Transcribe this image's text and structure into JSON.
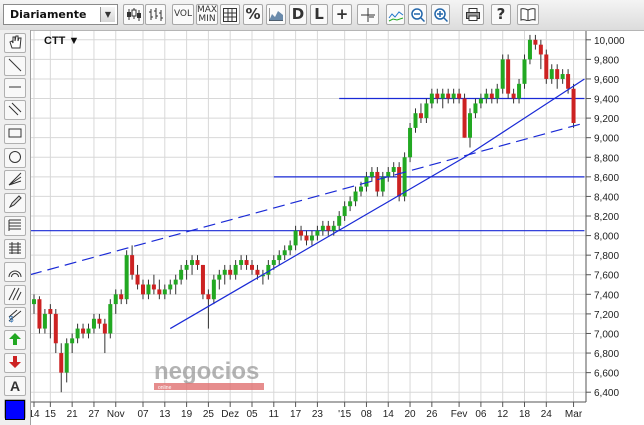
{
  "toolbar": {
    "period": "Diariamente",
    "buttons": [
      {
        "name": "candlestick-chart-button",
        "text": ""
      },
      {
        "name": "ohlc-chart-button",
        "text": ""
      },
      {
        "name": "volume-button",
        "text": "VOL"
      },
      {
        "name": "max-min-button",
        "text": "MAX MIN"
      },
      {
        "name": "grid-button",
        "text": ""
      },
      {
        "name": "percent-button",
        "text": "%"
      },
      {
        "name": "area-chart-button",
        "text": ""
      },
      {
        "name": "scale-d-button",
        "text": "D"
      },
      {
        "name": "scale-l-button",
        "text": "L"
      },
      {
        "name": "crosshair-button",
        "text": "+"
      },
      {
        "name": "cursor-button",
        "text": "+"
      },
      {
        "name": "zoom-area-button",
        "text": ""
      },
      {
        "name": "zoom-out-button",
        "text": ""
      },
      {
        "name": "zoom-in-button",
        "text": ""
      },
      {
        "name": "print-button",
        "text": ""
      },
      {
        "name": "help-button",
        "text": "?"
      },
      {
        "name": "book-button",
        "text": ""
      }
    ]
  },
  "sidebar": {
    "tools": [
      "hand-icon",
      "line-icon",
      "horizontal-line-icon",
      "channel-icon",
      "rectangle-icon",
      "ellipse-icon",
      "fan-icon",
      "pencil-icon",
      "fibonacci-icon",
      "grid-lines-icon",
      "arc-icon",
      "parallel-icon",
      "dollar-lines-icon",
      "arrow-up-icon",
      "arrow-down-icon",
      "text-icon",
      "delete-icon"
    ],
    "text_tool": "A",
    "color": "#0000ff"
  },
  "watermark": {
    "main": "negocios",
    "sub": "online"
  },
  "chart_data": {
    "type": "candlestick",
    "symbol": "CTT",
    "ylim": [
      6300,
      10100
    ],
    "yticks": [
      6400,
      6600,
      6800,
      7000,
      7200,
      7400,
      7600,
      7800,
      8000,
      8200,
      8400,
      8600,
      8800,
      9000,
      9200,
      9400,
      9600,
      9800,
      10000
    ],
    "ytick_labels": [
      "6,400",
      "6,600",
      "6,800",
      "7,000",
      "7,200",
      "7,400",
      "7,600",
      "7,800",
      "8,000",
      "8,200",
      "8,400",
      "8,600",
      "8,800",
      "9,000",
      "9,200",
      "9,400",
      "9,600",
      "9,800",
      "10,000"
    ],
    "xticks": [
      {
        "label": "14",
        "i": 0
      },
      {
        "label": "15",
        "i": 3
      },
      {
        "label": "21",
        "i": 7
      },
      {
        "label": "27",
        "i": 11
      },
      {
        "label": "Nov",
        "i": 15
      },
      {
        "label": "07",
        "i": 20
      },
      {
        "label": "13",
        "i": 24
      },
      {
        "label": "19",
        "i": 28
      },
      {
        "label": "25",
        "i": 32
      },
      {
        "label": "Dez",
        "i": 36
      },
      {
        "label": "05",
        "i": 40
      },
      {
        "label": "11",
        "i": 44
      },
      {
        "label": "17",
        "i": 48
      },
      {
        "label": "23",
        "i": 52
      },
      {
        "label": "'15",
        "i": 57
      },
      {
        "label": "08",
        "i": 61
      },
      {
        "label": "14",
        "i": 65
      },
      {
        "label": "20",
        "i": 69
      },
      {
        "label": "26",
        "i": 73
      },
      {
        "label": "Fev",
        "i": 78
      },
      {
        "label": "06",
        "i": 82
      },
      {
        "label": "12",
        "i": 86
      },
      {
        "label": "18",
        "i": 90
      },
      {
        "label": "24",
        "i": 94
      },
      {
        "label": "Mar",
        "i": 99
      }
    ],
    "candles": [
      [
        7300,
        7400,
        7200,
        7350
      ],
      [
        7350,
        7380,
        7000,
        7050
      ],
      [
        7050,
        7250,
        7000,
        7200
      ],
      [
        7250,
        7300,
        6950,
        7200
      ],
      [
        7200,
        7250,
        6800,
        6900
      ],
      [
        6800,
        6900,
        6400,
        6600
      ],
      [
        6600,
        6950,
        6500,
        6900
      ],
      [
        6900,
        7000,
        6800,
        6950
      ],
      [
        6950,
        7100,
        6900,
        7050
      ],
      [
        7050,
        7100,
        6950,
        7000
      ],
      [
        7000,
        7100,
        6950,
        7050
      ],
      [
        7050,
        7200,
        7000,
        7150
      ],
      [
        7150,
        7200,
        7050,
        7100
      ],
      [
        7100,
        7150,
        6800,
        7000
      ],
      [
        7000,
        7350,
        6950,
        7300
      ],
      [
        7300,
        7450,
        7200,
        7400
      ],
      [
        7400,
        7450,
        7300,
        7350
      ],
      [
        7350,
        7850,
        7300,
        7800
      ],
      [
        7800,
        7900,
        7550,
        7600
      ],
      [
        7600,
        7700,
        7450,
        7500
      ],
      [
        7500,
        7550,
        7350,
        7400
      ],
      [
        7400,
        7550,
        7350,
        7500
      ],
      [
        7500,
        7600,
        7400,
        7450
      ],
      [
        7450,
        7550,
        7350,
        7400
      ],
      [
        7400,
        7500,
        7350,
        7450
      ],
      [
        7450,
        7550,
        7400,
        7500
      ],
      [
        7500,
        7600,
        7400,
        7550
      ],
      [
        7550,
        7700,
        7500,
        7650
      ],
      [
        7650,
        7750,
        7550,
        7700
      ],
      [
        7700,
        7800,
        7600,
        7750
      ],
      [
        7750,
        7800,
        7650,
        7700
      ],
      [
        7700,
        7700,
        7350,
        7400
      ],
      [
        7400,
        7450,
        7050,
        7350
      ],
      [
        7350,
        7600,
        7300,
        7550
      ],
      [
        7550,
        7650,
        7450,
        7600
      ],
      [
        7600,
        7700,
        7500,
        7650
      ],
      [
        7650,
        7700,
        7550,
        7600
      ],
      [
        7600,
        7750,
        7550,
        7700
      ],
      [
        7700,
        7800,
        7650,
        7750
      ],
      [
        7750,
        7800,
        7650,
        7700
      ],
      [
        7700,
        7750,
        7600,
        7650
      ],
      [
        7650,
        7700,
        7550,
        7600
      ],
      [
        7600,
        7650,
        7500,
        7600
      ],
      [
        7600,
        7750,
        7550,
        7700
      ],
      [
        7700,
        7800,
        7650,
        7750
      ],
      [
        7750,
        7850,
        7700,
        7800
      ],
      [
        7800,
        7900,
        7750,
        7850
      ],
      [
        7850,
        7950,
        7800,
        7900
      ],
      [
        7900,
        8100,
        7850,
        8050
      ],
      [
        8050,
        8100,
        7950,
        8000
      ],
      [
        8000,
        8050,
        7900,
        7950
      ],
      [
        7950,
        8050,
        7900,
        8000
      ],
      [
        8000,
        8100,
        7950,
        8050
      ],
      [
        8050,
        8150,
        8000,
        8100
      ],
      [
        8100,
        8150,
        8000,
        8050
      ],
      [
        8050,
        8150,
        8000,
        8100
      ],
      [
        8100,
        8250,
        8050,
        8200
      ],
      [
        8200,
        8350,
        8150,
        8300
      ],
      [
        8300,
        8400,
        8250,
        8350
      ],
      [
        8350,
        8500,
        8300,
        8450
      ],
      [
        8450,
        8550,
        8400,
        8500
      ],
      [
        8500,
        8650,
        8450,
        8600
      ],
      [
        8600,
        8700,
        8550,
        8650
      ],
      [
        8650,
        8700,
        8400,
        8450
      ],
      [
        8450,
        8650,
        8400,
        8600
      ],
      [
        8600,
        8700,
        8550,
        8650
      ],
      [
        8650,
        8750,
        8600,
        8700
      ],
      [
        8700,
        8750,
        8350,
        8400
      ],
      [
        8400,
        8850,
        8350,
        8800
      ],
      [
        8800,
        9150,
        8750,
        9100
      ],
      [
        9100,
        9300,
        9050,
        9250
      ],
      [
        9250,
        9350,
        9150,
        9200
      ],
      [
        9200,
        9400,
        9150,
        9350
      ],
      [
        9350,
        9500,
        9300,
        9450
      ],
      [
        9450,
        9500,
        9350,
        9400
      ],
      [
        9400,
        9500,
        9300,
        9450
      ],
      [
        9450,
        9500,
        9350,
        9400
      ],
      [
        9400,
        9500,
        9350,
        9450
      ],
      [
        9450,
        9500,
        9350,
        9400
      ],
      [
        9400,
        9450,
        9000,
        9000
      ],
      [
        9000,
        9300,
        8900,
        9250
      ],
      [
        9250,
        9400,
        9200,
        9350
      ],
      [
        9350,
        9450,
        9300,
        9400
      ],
      [
        9400,
        9500,
        9350,
        9450
      ],
      [
        9450,
        9500,
        9350,
        9400
      ],
      [
        9400,
        9550,
        9350,
        9500
      ],
      [
        9500,
        9850,
        9450,
        9800
      ],
      [
        9800,
        9850,
        9400,
        9450
      ],
      [
        9450,
        9500,
        9350,
        9400
      ],
      [
        9400,
        9600,
        9350,
        9550
      ],
      [
        9550,
        9850,
        9500,
        9800
      ],
      [
        9800,
        10050,
        9750,
        10000
      ],
      [
        10000,
        10050,
        9900,
        9950
      ],
      [
        9950,
        10000,
        9700,
        9850
      ],
      [
        9850,
        9900,
        9550,
        9600
      ],
      [
        9600,
        9750,
        9550,
        9700
      ],
      [
        9700,
        9750,
        9500,
        9600
      ],
      [
        9600,
        9700,
        9550,
        9650
      ],
      [
        9650,
        9700,
        9450,
        9500
      ],
      [
        9500,
        9550,
        9100,
        9150
      ]
    ],
    "lines": [
      {
        "name": "support-trendline",
        "style": "solid",
        "points": [
          [
            25,
            7050
          ],
          [
            79,
            8800
          ],
          [
            101,
            9600
          ]
        ]
      },
      {
        "name": "dashed-trendline",
        "style": "dashed",
        "points": [
          [
            -1,
            7600
          ],
          [
            101,
            9150
          ]
        ]
      },
      {
        "name": "resistance-line-9400",
        "style": "solid",
        "points": [
          [
            56,
            9400
          ],
          [
            101,
            9400
          ]
        ]
      },
      {
        "name": "resistance-line-8600",
        "style": "solid",
        "points": [
          [
            44,
            8600
          ],
          [
            101,
            8600
          ]
        ]
      },
      {
        "name": "support-line-8050",
        "style": "solid",
        "points": [
          [
            -1,
            8050
          ],
          [
            101,
            8050
          ]
        ]
      }
    ],
    "colors": {
      "up": "#22a822",
      "down": "#cc2222",
      "line": "#1a2ad6",
      "grid": "#d8d8d8"
    }
  }
}
